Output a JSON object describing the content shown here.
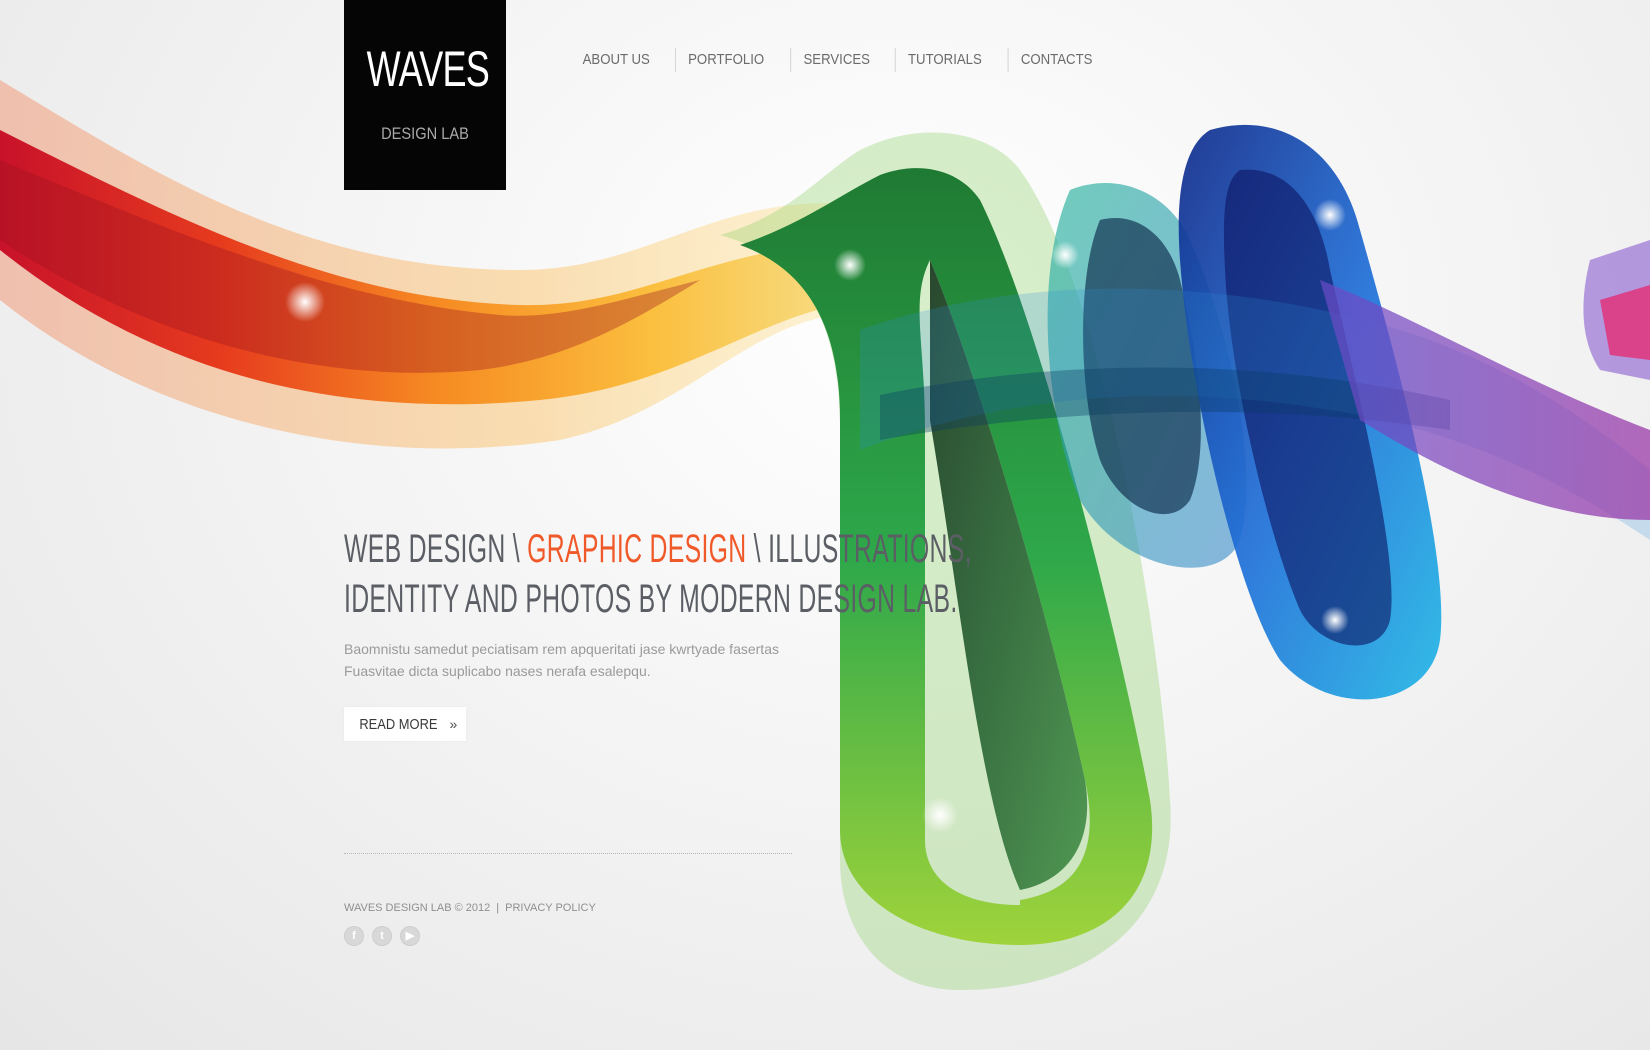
{
  "logo": {
    "title": "WAVES",
    "subtitle": "DESIGN LAB"
  },
  "nav": {
    "items": [
      {
        "label": "ABOUT US"
      },
      {
        "label": "PORTFOLIO"
      },
      {
        "label": "SERVICES"
      },
      {
        "label": "TUTORIALS"
      },
      {
        "label": "CONTACTS"
      }
    ]
  },
  "hero": {
    "headline_part1": "WEB DESIGN \\ ",
    "headline_accent": "GRAPHIC DESIGN",
    "headline_part2": " \\ ILLUSTRATIONS,",
    "headline_line2": "IDENTITY AND PHOTOS BY MODERN DESIGN LAB.",
    "intro_line1": "Baomnistu samedut peciatisam rem apqueritati jase kwrtyade fasertas",
    "intro_line2": "Fuasvitae dicta suplicabo nases nerafa esalepqu.",
    "read_more_label": "READ MORE",
    "read_more_icon": "»"
  },
  "footer": {
    "copyright": "WAVES DESIGN LAB © 2012",
    "separator": "|",
    "privacy": "PRIVACY POLICY",
    "social": [
      {
        "name": "facebook-icon",
        "glyph": "f"
      },
      {
        "name": "twitter-icon",
        "glyph": "t"
      },
      {
        "name": "youtube-icon",
        "glyph": "▶"
      }
    ]
  },
  "colors": {
    "accent": "#f05a2b",
    "logo_bg": "#050505",
    "text": "#5b5e65",
    "nav_text": "#6a6a6a"
  }
}
